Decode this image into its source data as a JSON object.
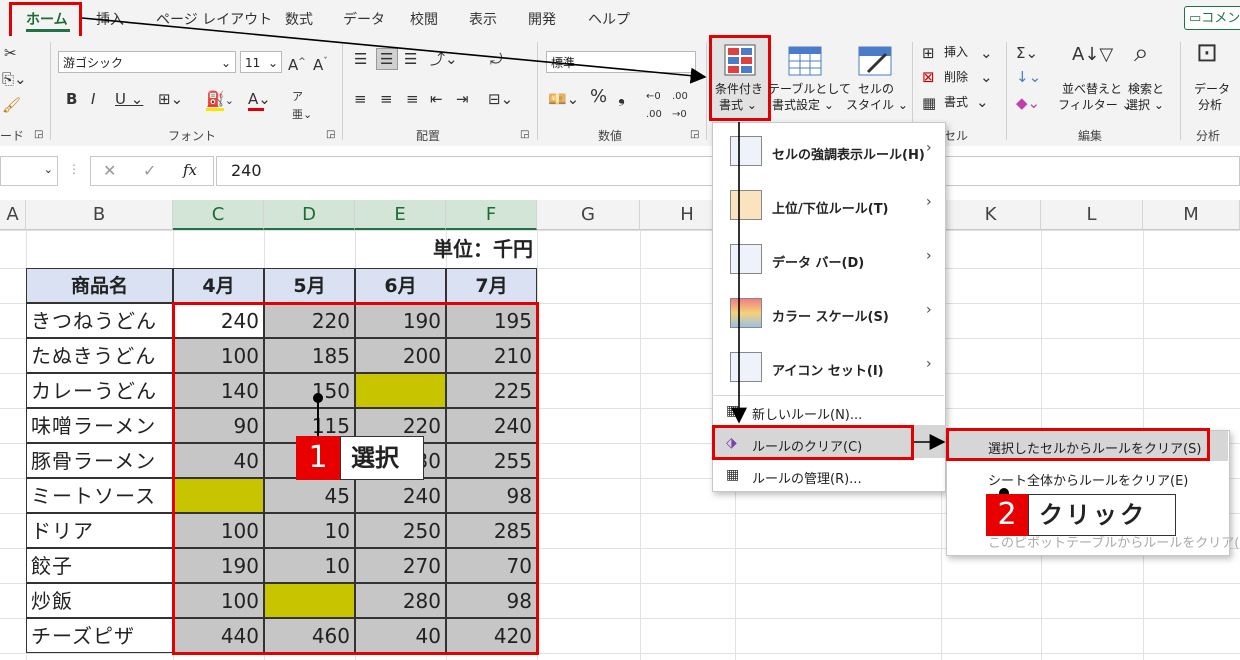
{
  "tabs": [
    "ホーム",
    "挿入",
    "ページ レイアウト",
    "数式",
    "データ",
    "校閲",
    "表示",
    "開発",
    "ヘルプ"
  ],
  "comment_button": "コメン",
  "clipboard": {
    "group_label": "ード"
  },
  "font": {
    "name": "游ゴシック",
    "size": "11",
    "group_label": "フォント"
  },
  "align": {
    "group_label": "配置"
  },
  "number": {
    "format": "標準",
    "group_label": "数値"
  },
  "styles": {
    "cond_format": [
      "条件付き",
      "書式 ⌄"
    ],
    "table_format": [
      "テーブルとして",
      "書式設定 ⌄"
    ],
    "cell_style": [
      "セルの",
      "スタイル ⌄"
    ]
  },
  "cells_group": {
    "insert": "挿入",
    "delete": "削除",
    "format": "書式",
    "group_label": "セル"
  },
  "editing": {
    "sort": [
      "並べ替えと",
      "フィルター ⌄"
    ],
    "find": [
      "検索と",
      "選択 ⌄"
    ],
    "group_label": "編集"
  },
  "analysis": {
    "label": [
      "データ",
      "分析"
    ],
    "group_label": "分析"
  },
  "formula_bar": {
    "value": "240",
    "fx": "fx"
  },
  "columns": [
    "A",
    "B",
    "C",
    "D",
    "E",
    "F",
    "G",
    "H",
    "K",
    "L",
    "M"
  ],
  "table": {
    "unit": "単位：千円",
    "headers": [
      "商品名",
      "4月",
      "5月",
      "6月",
      "7月"
    ],
    "rows": [
      [
        "きつねうどん",
        "240",
        "220",
        "190",
        "195"
      ],
      [
        "たぬきうどん",
        "100",
        "185",
        "200",
        "210"
      ],
      [
        "カレーうどん",
        "140",
        "150",
        "",
        "225"
      ],
      [
        "味噌ラーメン",
        "90",
        "115",
        "220",
        "240"
      ],
      [
        "豚骨ラーメン",
        "40",
        "",
        "230",
        "255"
      ],
      [
        "ミートソース",
        "",
        "45",
        "240",
        "98"
      ],
      [
        "ドリア",
        "100",
        "10",
        "250",
        "285"
      ],
      [
        "餃子",
        "190",
        "10",
        "270",
        "70"
      ],
      [
        "炒飯",
        "100",
        "",
        "280",
        "98"
      ],
      [
        "チーズピザ",
        "440",
        "460",
        "40",
        "420"
      ]
    ]
  },
  "cf_menu": {
    "items": [
      "セルの強調表示ルール(H)",
      "上位/下位ルール(T)",
      "データ バー(D)",
      "カラー スケール(S)",
      "アイコン セット(I)"
    ],
    "new_rule": "新しいルール(N)...",
    "clear_rules": "ルールのクリア(C)",
    "manage_rules": "ルールの管理(R)..."
  },
  "clear_submenu": {
    "items": [
      "選択したセルからルールをクリア(S)",
      "シート全体からルールをクリア(E)",
      "このピボットテーブルからルールをクリア(P)"
    ]
  },
  "annotations": {
    "one_num": "1",
    "one_text": "選択",
    "two_num": "2",
    "two_text": "クリック"
  },
  "colors": {
    "accent": "#217346",
    "red": "#e30000",
    "yellow": "#c8c400",
    "gray": "#c6c6c6",
    "header_blue": "#d9e1f2"
  }
}
